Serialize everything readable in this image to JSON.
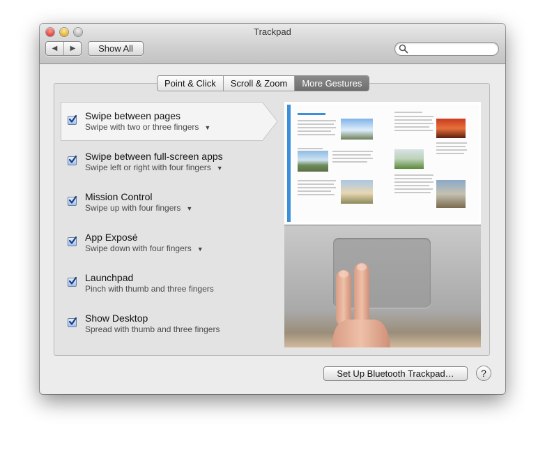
{
  "window": {
    "title": "Trackpad"
  },
  "toolbar": {
    "back_icon": "◀",
    "forward_icon": "▶",
    "show_all_label": "Show All",
    "search_placeholder": ""
  },
  "tabs": [
    {
      "label": "Point & Click",
      "selected": false
    },
    {
      "label": "Scroll & Zoom",
      "selected": false
    },
    {
      "label": "More Gestures",
      "selected": true
    }
  ],
  "gestures": [
    {
      "title": "Swipe between pages",
      "subtitle": "Swipe with two or three fingers",
      "checked": true,
      "has_menu": true,
      "selected": true
    },
    {
      "title": "Swipe between full-screen apps",
      "subtitle": "Swipe left or right with four fingers",
      "checked": true,
      "has_menu": true,
      "selected": false
    },
    {
      "title": "Mission Control",
      "subtitle": "Swipe up with four fingers",
      "checked": true,
      "has_menu": true,
      "selected": false
    },
    {
      "title": "App Exposé",
      "subtitle": "Swipe down with four fingers",
      "checked": true,
      "has_menu": true,
      "selected": false
    },
    {
      "title": "Launchpad",
      "subtitle": "Pinch with thumb and three fingers",
      "checked": true,
      "has_menu": false,
      "selected": false
    },
    {
      "title": "Show Desktop",
      "subtitle": "Spread with thumb and three fingers",
      "checked": true,
      "has_menu": false,
      "selected": false
    }
  ],
  "footer": {
    "bluetooth_label": "Set Up Bluetooth Trackpad…",
    "help_label": "?"
  },
  "colors": {
    "selected_tab": "#7a7a7a",
    "checkbox_check": "#1c3b7a",
    "book_accent": "#3b8fd9"
  }
}
